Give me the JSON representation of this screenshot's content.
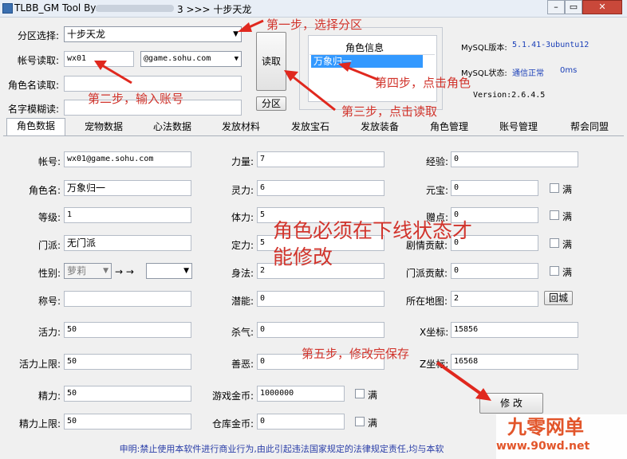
{
  "window": {
    "title": "TLBB_GM Tool By:",
    "title_suffix": "3 >>> 十步天龙"
  },
  "login": {
    "server_label": "分区选择:",
    "server_value": "十步天龙",
    "account_label": "帐号读取:",
    "account_value": "wx01",
    "domain_value": "@game.sohu.com",
    "role_name_label": "角色名读取:",
    "role_name_value": "",
    "fuzzy_label": "名字模糊读:",
    "fuzzy_value": "",
    "read_button": "读取",
    "zone_button": "分区"
  },
  "role_info": {
    "header": "角色信息",
    "items": [
      "万象归一"
    ]
  },
  "mysql": {
    "version_label": "MySQL版本:",
    "version_value": "5.1.41-3ubuntu12",
    "status_label": "MySQL状态:",
    "status_value": "通信正常",
    "status_ms": "0ms",
    "version_line": "Version:2.6.4.5"
  },
  "tabs": [
    "角色数据",
    "宠物数据",
    "心法数据",
    "发放材料",
    "发放宝石",
    "发放装备",
    "角色管理",
    "账号管理",
    "帮会同盟"
  ],
  "fields": {
    "account_label": "帐号:",
    "account_value": "wx01@game.sohu.com",
    "role_label": "角色名:",
    "role_value": "万象归一",
    "level_label": "等级:",
    "level_value": "1",
    "sect_label": "门派:",
    "sect_value": "无门派",
    "gender_label": "性别:",
    "gender_value": "萝莉",
    "gender_arrow": "→ →",
    "nick_label": "称号:",
    "nick_value": "",
    "vigor_label": "活力:",
    "vigor_value": "50",
    "vigor_max_label": "活力上限:",
    "vigor_max_value": "50",
    "energy_label": "精力:",
    "energy_value": "50",
    "energy_max_label": "精力上限:",
    "energy_max_value": "50",
    "str_label": "力量:",
    "str_value": "7",
    "spi_label": "灵力:",
    "spi_value": "6",
    "con_label": "体力:",
    "con_value": "5",
    "int_label": "定力:",
    "int_value": "5",
    "agi_label": "身法:",
    "agi_value": "2",
    "pot_label": "潜能:",
    "pot_value": "0",
    "kill_label": "杀气:",
    "kill_value": "0",
    "good_label": "善恶:",
    "good_value": "0",
    "gold_label": "游戏金币:",
    "gold_value": "1000000",
    "bank_label": "仓库金币:",
    "bank_value": "0",
    "exp_label": "经验:",
    "exp_value": "0",
    "yb_label": "元宝:",
    "yb_value": "0",
    "zd_label": "赠点:",
    "zd_value": "0",
    "story_label": "剧情贡献:",
    "story_value": "0",
    "sect_contrib_label": "门派贡献:",
    "sect_contrib_value": "0",
    "map_label": "所在地图:",
    "map_value": "2",
    "x_label": "X坐标:",
    "x_value": "15856",
    "z_label": "Z坐标:",
    "z_value": "16568",
    "full_label": "满",
    "return_city_button": "回城",
    "modify_button": "修 改"
  },
  "annotations": {
    "step1": "第一步，选择分区",
    "step2": "第二步，输入账号",
    "step3": "第三步，点击读取",
    "step4": "第四步，点击角色",
    "step5": "第五步，修改完保存",
    "warning_line1": "角色必须在下线状态才",
    "warning_line2": "能修改"
  },
  "footer": "申明:禁止使用本软件进行商业行为,由此引起违法国家规定的法律规定责任,均与本软",
  "watermark": {
    "name": "九零网单",
    "url": "www.90wd.net"
  },
  "colors": {
    "accent": "#d1342c",
    "selection": "#3399ff",
    "footer_text": "#2a3ea8",
    "status_ok": "#1a3fb8"
  }
}
